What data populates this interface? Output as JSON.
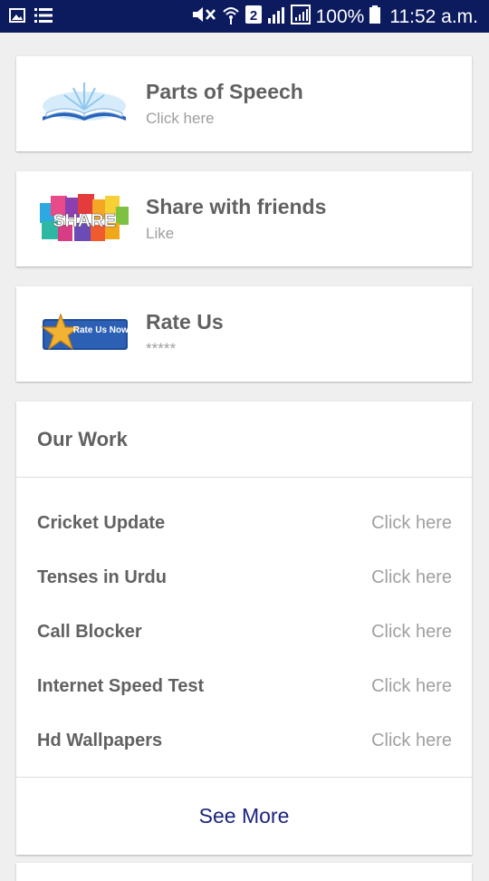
{
  "status_bar": {
    "icons_left": [
      "image-icon",
      "menu-list-icon"
    ],
    "icons_right": [
      "mute-icon",
      "wifi-icon",
      "sim2-icon",
      "signal-icon",
      "signal-icon-2"
    ],
    "battery": "100%",
    "time": "11:52 a.m."
  },
  "cards": [
    {
      "title": "Parts of Speech",
      "subtitle": "Click here",
      "icon": "open-book-icon"
    },
    {
      "title": "Share with friends",
      "subtitle": "Like",
      "icon": "share-icon"
    },
    {
      "title": "Rate Us",
      "subtitle": "*****",
      "icon": "rate-us-star-icon",
      "icon_text": "Rate Us Now!"
    }
  ],
  "our_work": {
    "heading": "Our Work",
    "items": [
      {
        "name": "Cricket Update",
        "link": "Click here"
      },
      {
        "name": "Tenses in Urdu",
        "link": "Click here"
      },
      {
        "name": "Call Blocker",
        "link": "Click here"
      },
      {
        "name": "Internet Speed Test",
        "link": "Click here"
      },
      {
        "name": "Hd Wallpapers",
        "link": "Click here"
      }
    ],
    "see_more": "See More"
  },
  "colors": {
    "status_bar": "#0c1a5e",
    "background": "#efefef",
    "title_text": "#616161",
    "link_text": "#a0a0a0",
    "see_more": "#1b237e"
  }
}
